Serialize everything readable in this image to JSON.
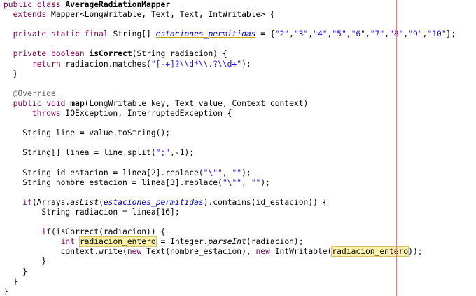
{
  "editor": {
    "lines": [
      [
        {
          "t": "public class ",
          "c": "kw"
        },
        {
          "t": "AverageRadiationMapper",
          "c": "bold"
        }
      ],
      [
        {
          "t": "  "
        },
        {
          "t": "extends ",
          "c": "kw"
        },
        {
          "t": "Mapper<LongWritable, Text, Text, IntWritable> {"
        }
      ],
      [
        {
          "t": ""
        }
      ],
      [
        {
          "t": "  "
        },
        {
          "t": "private static final ",
          "c": "kw"
        },
        {
          "t": "String[] "
        },
        {
          "t": "estaciones_permitidas",
          "c": "fld ul"
        },
        {
          "t": " = {"
        },
        {
          "t": "\"2\"",
          "c": "str"
        },
        {
          "t": ","
        },
        {
          "t": "\"3\"",
          "c": "str"
        },
        {
          "t": ","
        },
        {
          "t": "\"4\"",
          "c": "str"
        },
        {
          "t": ","
        },
        {
          "t": "\"5\"",
          "c": "str"
        },
        {
          "t": ","
        },
        {
          "t": "\"6\"",
          "c": "str"
        },
        {
          "t": ","
        },
        {
          "t": "\"7\"",
          "c": "str"
        },
        {
          "t": ","
        },
        {
          "t": "\"8\"",
          "c": "str"
        },
        {
          "t": ","
        },
        {
          "t": "\"9\"",
          "c": "str"
        },
        {
          "t": ","
        },
        {
          "t": "\"10\"",
          "c": "str"
        },
        {
          "t": "};"
        }
      ],
      [
        {
          "t": ""
        }
      ],
      [
        {
          "t": "  "
        },
        {
          "t": "private boolean ",
          "c": "kw"
        },
        {
          "t": "isCorrect",
          "c": "bold"
        },
        {
          "t": "(String radiacion) {"
        }
      ],
      [
        {
          "t": "      "
        },
        {
          "t": "return ",
          "c": "kw"
        },
        {
          "t": "radiacion.matches("
        },
        {
          "t": "\"[-+]?\\\\d*\\\\.?\\\\d+\"",
          "c": "str"
        },
        {
          "t": ");"
        }
      ],
      [
        {
          "t": "  }"
        }
      ],
      [
        {
          "t": ""
        }
      ],
      [
        {
          "t": "  "
        },
        {
          "t": "@Override",
          "c": "ann"
        }
      ],
      [
        {
          "t": "  "
        },
        {
          "t": "public void ",
          "c": "kw"
        },
        {
          "t": "map",
          "c": "bold"
        },
        {
          "t": "(LongWritable key, Text value, Context context)"
        }
      ],
      [
        {
          "t": "      "
        },
        {
          "t": "throws ",
          "c": "kw"
        },
        {
          "t": "IOException, InterruptedException {"
        }
      ],
      [
        {
          "t": ""
        }
      ],
      [
        {
          "t": "    String line = value.toString();"
        }
      ],
      [
        {
          "t": ""
        }
      ],
      [
        {
          "t": "    String[] linea = line.split("
        },
        {
          "t": "\";\"",
          "c": "str"
        },
        {
          "t": ",-1);"
        }
      ],
      [
        {
          "t": ""
        }
      ],
      [
        {
          "t": "    String id_estacion = linea[2].replace("
        },
        {
          "t": "\"\\\"\"",
          "c": "str"
        },
        {
          "t": ", "
        },
        {
          "t": "\"\"",
          "c": "str"
        },
        {
          "t": ");"
        }
      ],
      [
        {
          "t": "    String nombre_estacion = linea[3].replace("
        },
        {
          "t": "\"\\\"\"",
          "c": "str"
        },
        {
          "t": ", "
        },
        {
          "t": "\"\"",
          "c": "str"
        },
        {
          "t": ");"
        }
      ],
      [
        {
          "t": ""
        }
      ],
      [
        {
          "t": "    "
        },
        {
          "t": "if",
          "c": "kw"
        },
        {
          "t": "(Arrays."
        },
        {
          "t": "asList",
          "c": "it"
        },
        {
          "t": "("
        },
        {
          "t": "estaciones_permitidas",
          "c": "fld"
        },
        {
          "t": ").contains(id_estacion)) {"
        }
      ],
      [
        {
          "t": "        String radiacion = linea[16];"
        }
      ],
      [
        {
          "t": ""
        }
      ],
      [
        {
          "t": "        "
        },
        {
          "t": "if",
          "c": "kw"
        },
        {
          "t": "(isCorrect(radiacion)) {"
        }
      ],
      [
        {
          "t": "            "
        },
        {
          "t": "int ",
          "c": "kw"
        },
        {
          "t": "radiacion_entero",
          "c": "hl"
        },
        {
          "t": " = Integer."
        },
        {
          "t": "parseInt",
          "c": "it"
        },
        {
          "t": "(radiacion);"
        }
      ],
      [
        {
          "t": "            context.write("
        },
        {
          "t": "new ",
          "c": "kw"
        },
        {
          "t": "Text(nombre_estacion), "
        },
        {
          "t": "new ",
          "c": "kw"
        },
        {
          "t": "IntWritable("
        },
        {
          "t": "radiacion_entero",
          "c": "hl"
        },
        {
          "t": "));"
        }
      ],
      [
        {
          "t": "        }"
        }
      ],
      [
        {
          "t": "    }"
        }
      ],
      [
        {
          "t": "  }"
        }
      ],
      [
        {
          "t": "}"
        }
      ]
    ]
  }
}
